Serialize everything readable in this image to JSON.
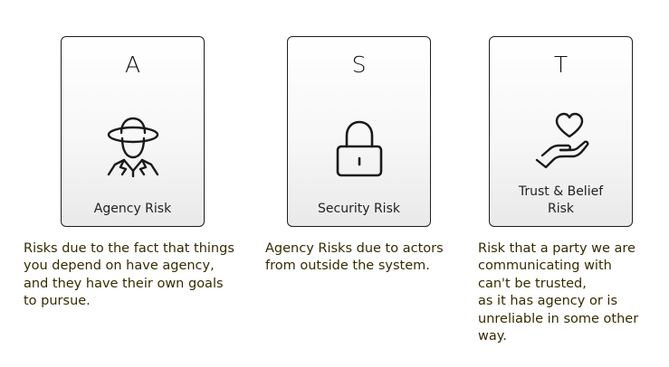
{
  "cards": [
    {
      "letter": "A",
      "icon": "spy-agent-icon",
      "title_lines": [
        "Agency Risk"
      ],
      "description_lines": [
        "Risks due to the fact that things",
        "you depend on have agency,",
        "and they have their own goals",
        "to pursue."
      ]
    },
    {
      "letter": "S",
      "icon": "padlock-icon",
      "title_lines": [
        "Security Risk"
      ],
      "description_lines": [
        "Agency Risks due to actors",
        "from outside the system."
      ]
    },
    {
      "letter": "T",
      "icon": "heart-in-hand-icon",
      "title_lines": [
        "Trust & Belief",
        "Risk"
      ],
      "description_lines": [
        "Risk that a party we are",
        "communicating with",
        "can't be trusted,",
        "as it has agency or is",
        "unreliable in some other",
        "way."
      ]
    }
  ]
}
